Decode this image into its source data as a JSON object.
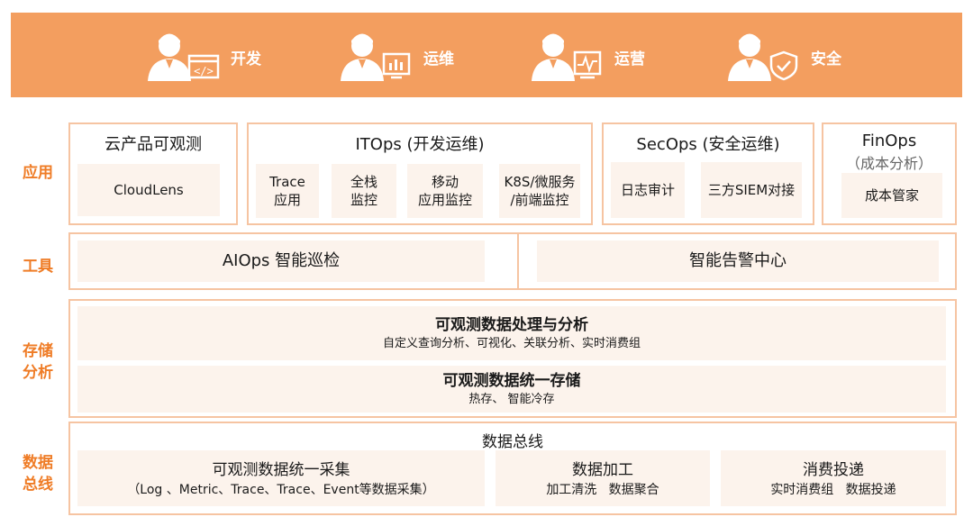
{
  "roles": [
    {
      "label": "开发",
      "icon": "developer-icon"
    },
    {
      "label": "运维",
      "icon": "ops-icon"
    },
    {
      "label": "运营",
      "icon": "operations-icon"
    },
    {
      "label": "安全",
      "icon": "security-icon"
    }
  ],
  "row_labels": {
    "app": "应用",
    "tools": "工具",
    "storage": "存储\n分析",
    "bus": "数据\n总线"
  },
  "app": {
    "cloud": {
      "title": "云产品可观测",
      "item": "CloudLens"
    },
    "itops": {
      "title": "ITOps (开发运维)",
      "items": [
        "Trace\n应用",
        "全栈\n监控",
        "移动\n应用监控",
        "K8S/微服务\n/前端监控"
      ]
    },
    "secops": {
      "title": "SecOps (安全运维)",
      "items": [
        "日志审计",
        "三方SIEM对接"
      ]
    },
    "finops": {
      "title": "FinOps",
      "subtitle": "（成本分析）",
      "item": "成本管家"
    }
  },
  "tools": {
    "left": "AIOps 智能巡检",
    "right": "智能告警中心"
  },
  "storage": {
    "analysis_title": "可观测数据处理与分析",
    "analysis_sub": "自定义查询分析、可视化、关联分析、实时消费组",
    "store_title": "可观测数据统一存储",
    "store_sub": "热存、 智能冷存"
  },
  "bus": {
    "title": "数据总线",
    "collect_title": "可观测数据统一采集",
    "collect_sub": "（Log 、Metric、Trace、Trace、Event等数据采集）",
    "process_title": "数据加工",
    "process_sub": "加工清洗   数据聚合",
    "deliver_title": "消费投递",
    "deliver_sub": "实时消费组   数据投递"
  },
  "colors": {
    "banner": "#f39e5f",
    "accent": "#ef7c26",
    "frame": "#f6c4a2",
    "cell": "#fcf3ec"
  }
}
